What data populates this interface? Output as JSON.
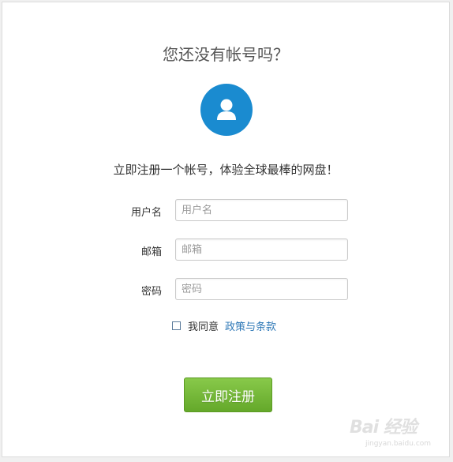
{
  "form": {
    "title": "您还没有帐号吗？",
    "subtitle": "立即注册一个帐号，体验全球最棒的网盘！",
    "username": {
      "label": "用户名",
      "placeholder": "用户名",
      "value": ""
    },
    "email": {
      "label": "邮箱",
      "placeholder": "邮箱",
      "value": ""
    },
    "password": {
      "label": "密码",
      "placeholder": "密码",
      "value": ""
    },
    "agree": {
      "text": "我同意",
      "link": "政策与条款",
      "checked": false
    },
    "submit_label": "立即注册"
  },
  "colors": {
    "accent_blue": "#1a8bd0",
    "button_green": "#6db33f",
    "link_blue": "#2e78b7"
  },
  "icons": {
    "avatar": "user-icon"
  },
  "watermark": {
    "logo": "Bai 经验",
    "url": "jingyan.baidu.com"
  }
}
